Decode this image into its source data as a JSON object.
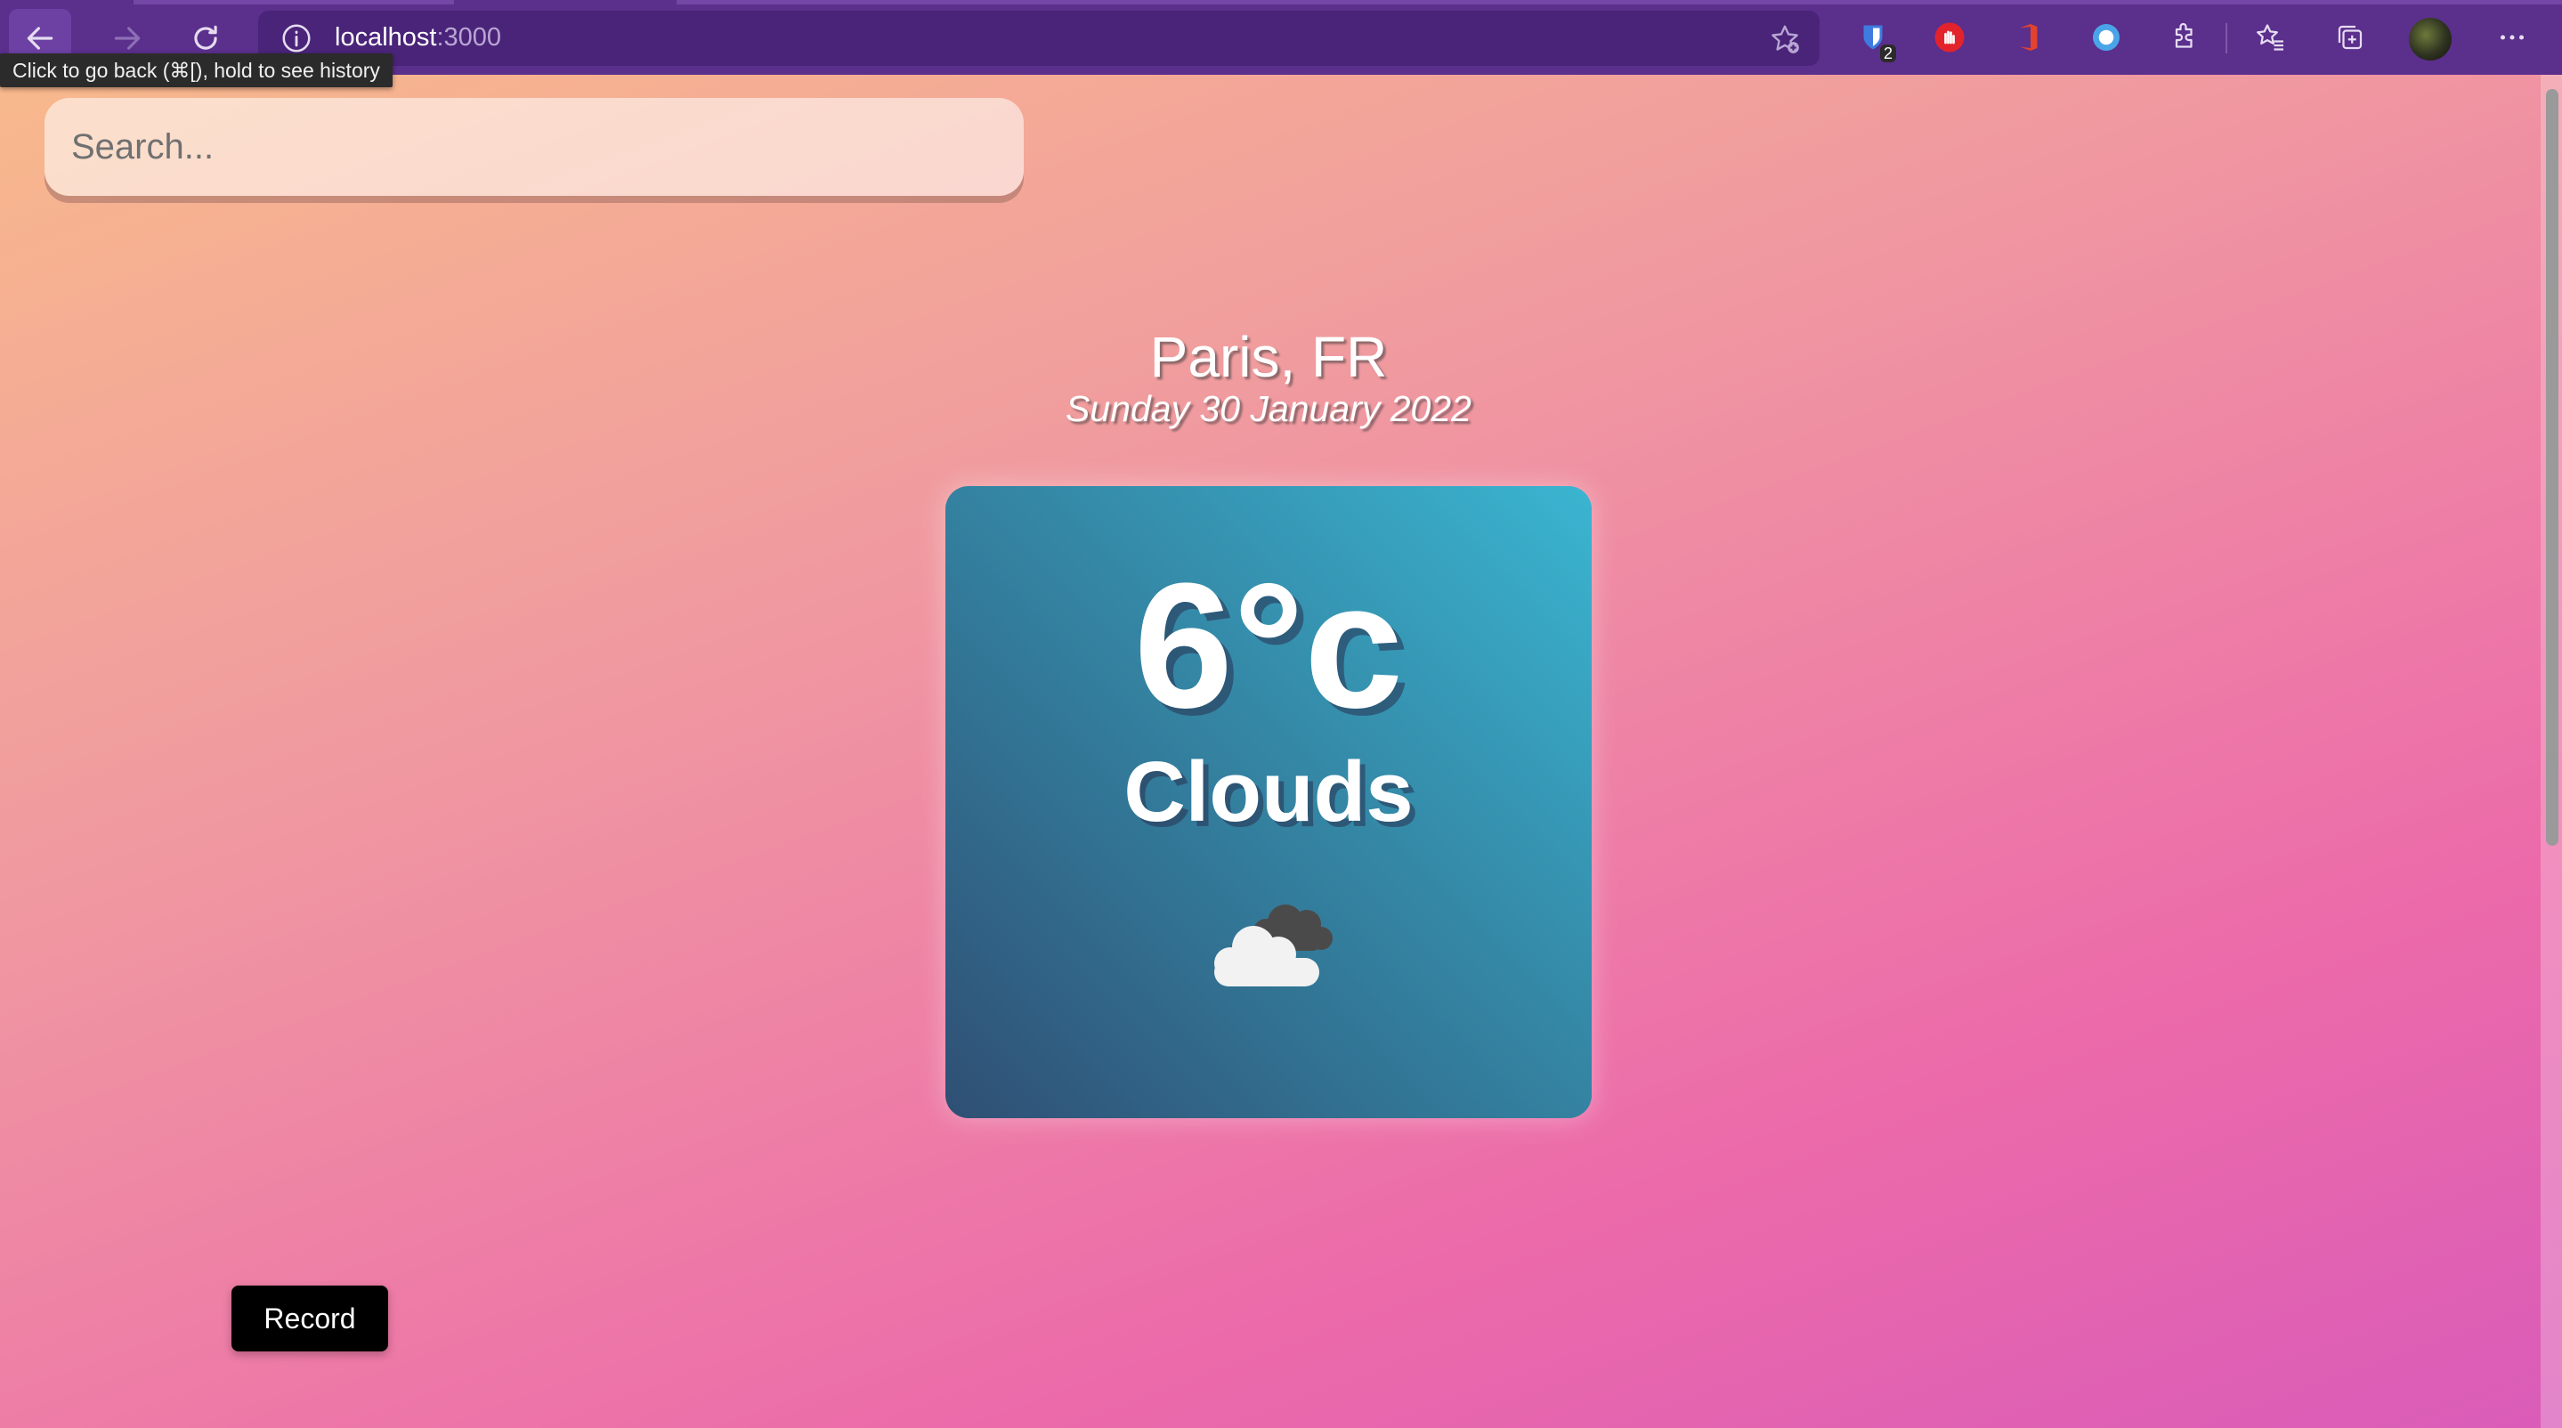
{
  "browser": {
    "tooltip": "Click to go back (⌘[), hold to see history",
    "address": {
      "host": "localhost",
      "port": ":3000"
    },
    "extensions": [
      {
        "icon": "shield-extension-icon",
        "badge": "2"
      },
      {
        "icon": "hand-extension-icon"
      },
      {
        "icon": "office-extension-icon"
      },
      {
        "icon": "circle-extension-icon"
      },
      {
        "icon": "puzzle-icon"
      },
      {
        "icon": "favorites-icon"
      },
      {
        "icon": "collections-icon"
      }
    ]
  },
  "search": {
    "placeholder": "Search..."
  },
  "weather": {
    "location": "Paris, FR",
    "date": "Sunday 30 January 2022",
    "temperature": "6°c",
    "condition": "Clouds",
    "icon": "clouds-icon"
  },
  "actions": {
    "record_label": "Record"
  },
  "colors": {
    "toolbar": "#5b2f8c",
    "card_top": "#3ab5d1",
    "card_bottom": "#2f4f74",
    "button": "#000000"
  }
}
